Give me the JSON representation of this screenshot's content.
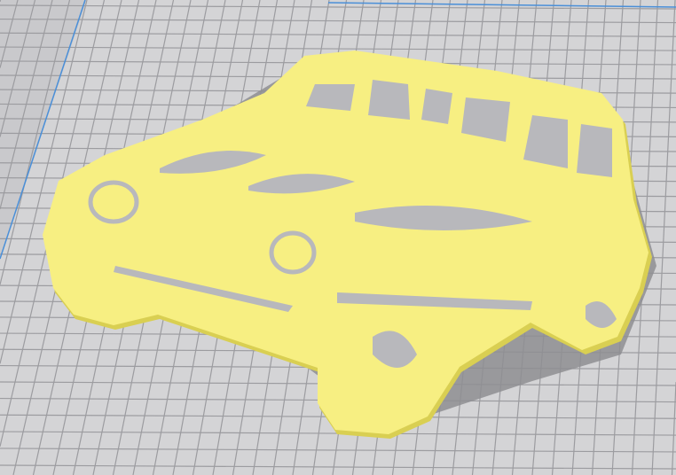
{
  "viewer": {
    "plate_color": "#d4d4d6",
    "grid_color": "#9c9ca0",
    "plate_edge_color": "#4a8fd8",
    "model_color": "#f7ef82",
    "model_shade_color": "#d9cf52",
    "shadow_color": "#8e8e92"
  }
}
